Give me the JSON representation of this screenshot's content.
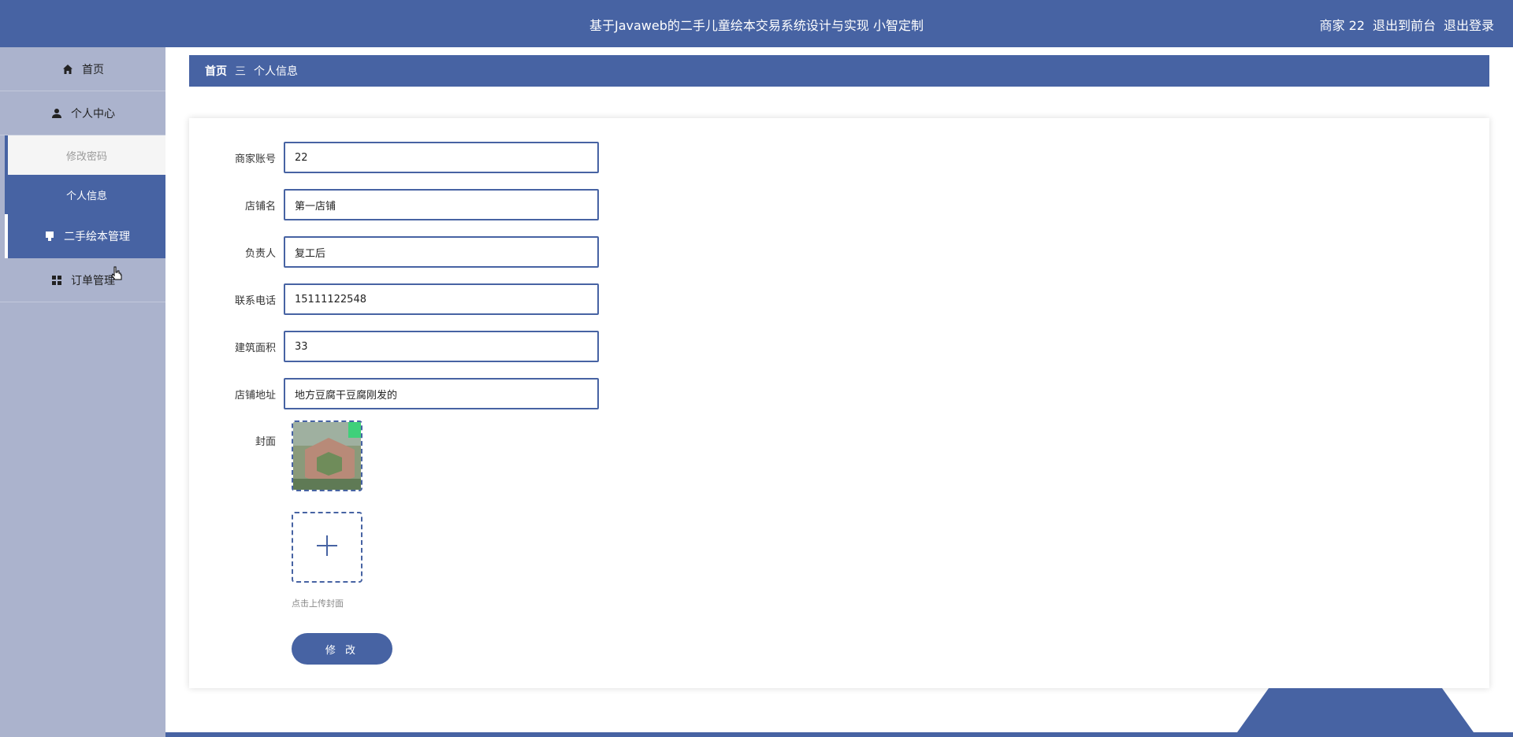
{
  "header": {
    "title": "基于Javaweb的二手儿童绘本交易系统设计与实现 小智定制",
    "user": "商家 22",
    "back_to_front": "退出到前台",
    "logout": "退出登录"
  },
  "sidebar": {
    "items": [
      {
        "label": "首页",
        "icon": "home-icon"
      },
      {
        "label": "个人中心",
        "icon": "user-icon"
      },
      {
        "label": "修改密码"
      },
      {
        "label": "个人信息"
      },
      {
        "label": "二手绘本管理",
        "icon": "book-icon"
      },
      {
        "label": "订单管理",
        "icon": "grid-icon"
      }
    ]
  },
  "breadcrumb": {
    "home": "首页",
    "separator": "三",
    "current": "个人信息"
  },
  "form": {
    "fields": [
      {
        "label": "商家账号",
        "value": "22"
      },
      {
        "label": "店铺名",
        "value": "第一店铺"
      },
      {
        "label": "负责人",
        "value": "复工后"
      },
      {
        "label": "联系电话",
        "value": "15111122548"
      },
      {
        "label": "建筑面积",
        "value": "33"
      },
      {
        "label": "店铺地址",
        "value": "地方豆腐干豆腐刚发的"
      }
    ],
    "cover_label": "封面",
    "upload_tip": "点击上传封面",
    "submit_label": "修 改"
  },
  "colors": {
    "primary": "#4763a3",
    "sidebar_bg": "#abb3cd"
  }
}
